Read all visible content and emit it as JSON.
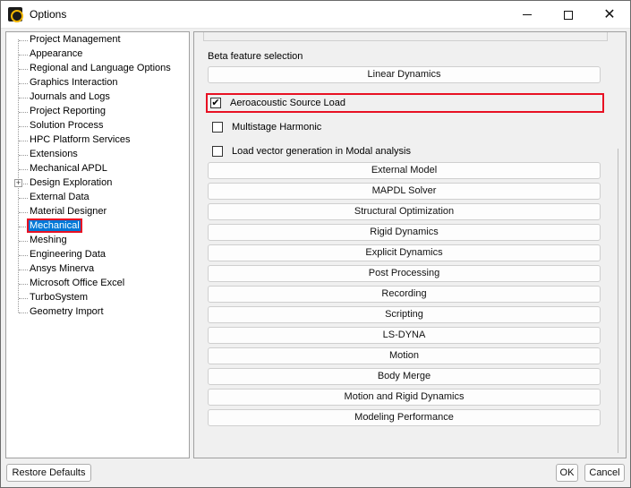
{
  "window": {
    "title": "Options",
    "icon": "ansys-options-icon"
  },
  "tree": {
    "items": [
      {
        "label": "Project Management"
      },
      {
        "label": "Appearance"
      },
      {
        "label": "Regional and Language Options"
      },
      {
        "label": "Graphics Interaction"
      },
      {
        "label": "Journals and Logs"
      },
      {
        "label": "Project Reporting"
      },
      {
        "label": "Solution Process"
      },
      {
        "label": "HPC Platform Services"
      },
      {
        "label": "Extensions"
      },
      {
        "label": "Mechanical APDL"
      },
      {
        "label": "Design Exploration",
        "expander": "+"
      },
      {
        "label": "External Data"
      },
      {
        "label": "Material Designer"
      },
      {
        "label": "Mechanical",
        "selected": true
      },
      {
        "label": "Meshing"
      },
      {
        "label": "Engineering Data"
      },
      {
        "label": "Ansys Minerva"
      },
      {
        "label": "Microsoft Office Excel"
      },
      {
        "label": "TurboSystem"
      },
      {
        "label": "Geometry Import"
      }
    ]
  },
  "panel": {
    "group_title": "Beta feature selection",
    "linear_dynamics": "Linear Dynamics",
    "checkboxes": [
      {
        "label": "Aeroacoustic Source Load",
        "checked": true
      },
      {
        "label": "Multistage Harmonic",
        "checked": false
      },
      {
        "label": "Load vector generation in Modal analysis",
        "checked": false
      }
    ],
    "sections": [
      "External Model",
      "MAPDL Solver",
      "Structural Optimization",
      "Rigid Dynamics",
      "Explicit Dynamics",
      "Post Processing",
      "Recording",
      "Scripting",
      "LS-DYNA",
      "Motion",
      "Body Merge",
      "Motion and Rigid Dynamics",
      "Modeling Performance"
    ]
  },
  "buttons": {
    "restore": "Restore Defaults",
    "ok": "OK",
    "cancel": "Cancel"
  },
  "colors": {
    "selection": "#0078d7",
    "highlight": "#e81123"
  }
}
